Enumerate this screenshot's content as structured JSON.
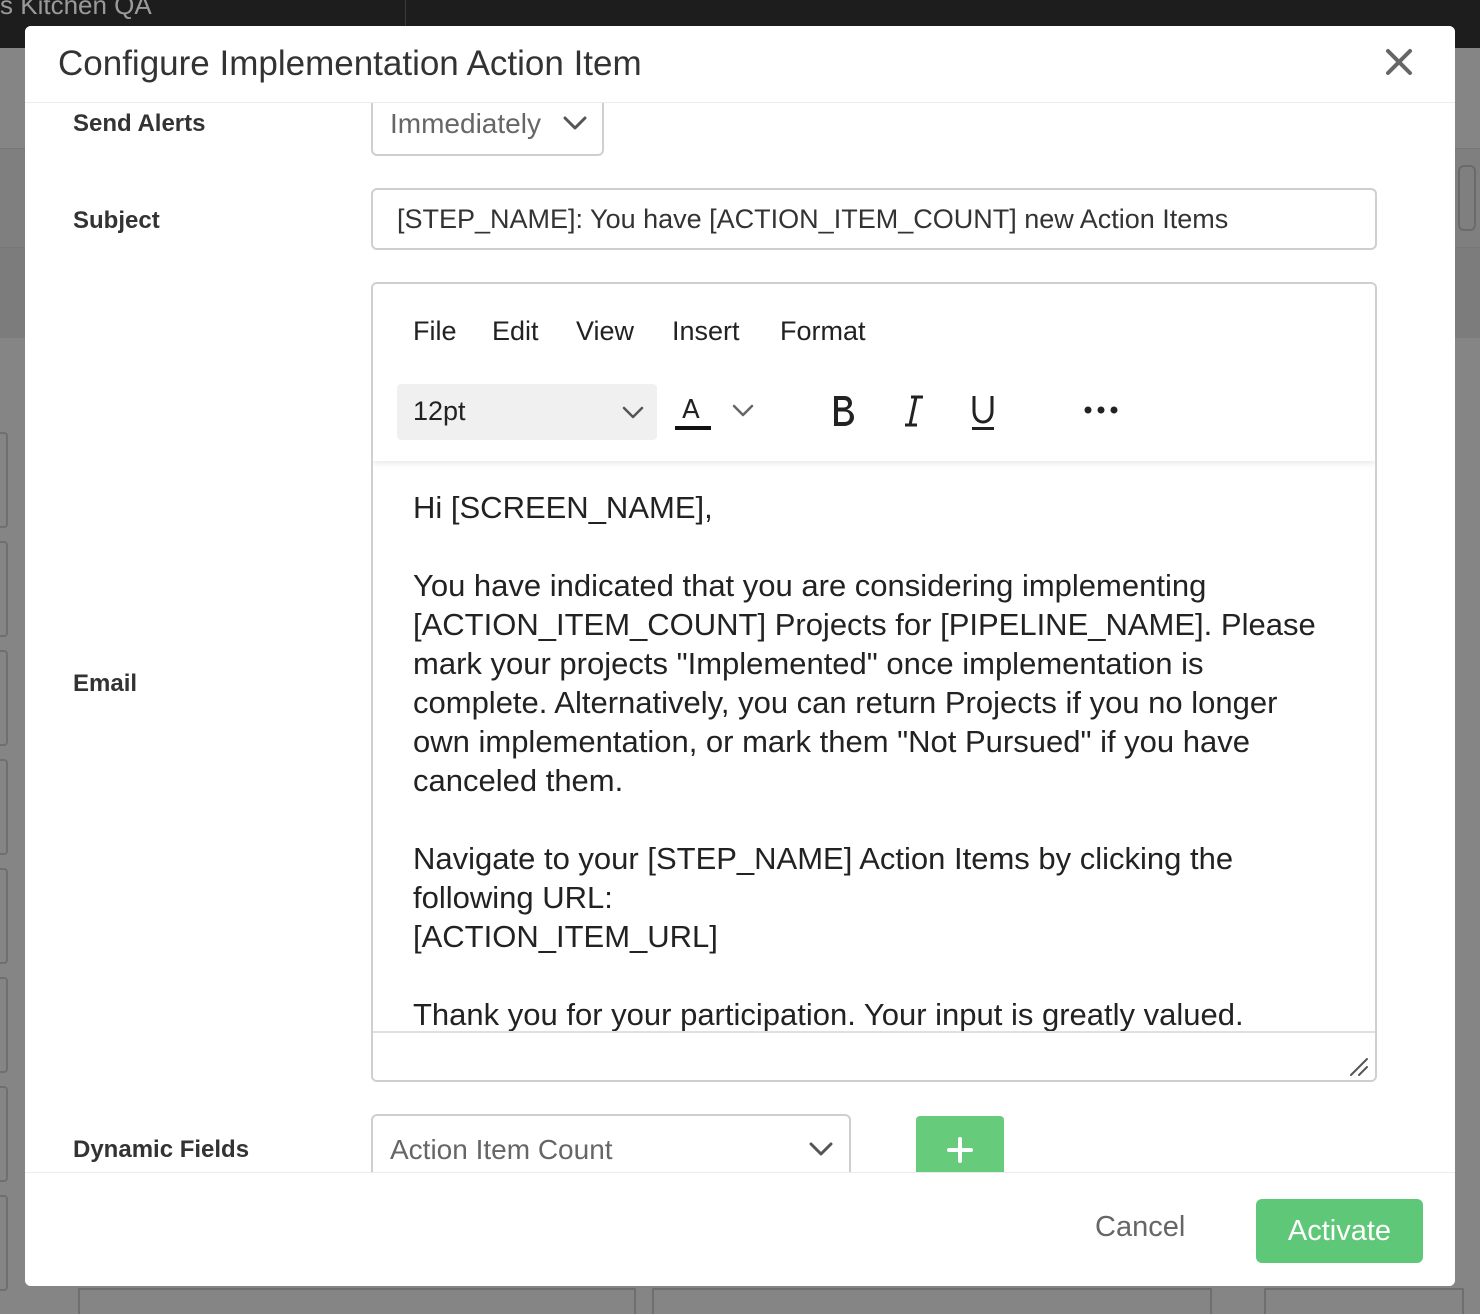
{
  "background": {
    "app_title": "s Kitchen QA"
  },
  "modal": {
    "title": "Configure Implementation Action Item",
    "close_icon": "close-icon"
  },
  "form": {
    "send_alerts": {
      "label": "Send Alerts",
      "value": "Immediately"
    },
    "subject": {
      "label": "Subject",
      "value": "[STEP_NAME]: You have [ACTION_ITEM_COUNT] new Action Items"
    },
    "email": {
      "label": "Email",
      "menu": [
        "File",
        "Edit",
        "View",
        "Insert",
        "Format"
      ],
      "font_size": "12pt",
      "toolbar_icons": [
        "text-color-icon",
        "bold-icon",
        "italic-icon",
        "underline-icon",
        "more-icon"
      ],
      "body": [
        "Hi [SCREEN_NAME],",
        "You have indicated that you are considering implementing [ACTION_ITEM_COUNT] Projects for [PIPELINE_NAME]. Please mark your projects \"Implemented\" once implementation is complete. Alternatively, you can return Projects if you no longer own implementation, or mark them \"Not Pursued\" if you have canceled them.",
        "Navigate to your [STEP_NAME] Action Items by clicking the following URL:",
        "[ACTION_ITEM_URL]",
        "Thank you for your participation. Your input is greatly valued."
      ]
    },
    "dynamic_fields": {
      "label": "Dynamic Fields",
      "value": "Action Item Count"
    }
  },
  "footer": {
    "cancel_label": "Cancel",
    "activate_label": "Activate"
  },
  "colors": {
    "primary_green": "#5fc878",
    "border": "#cfcfcf",
    "text_dark": "#333333"
  }
}
